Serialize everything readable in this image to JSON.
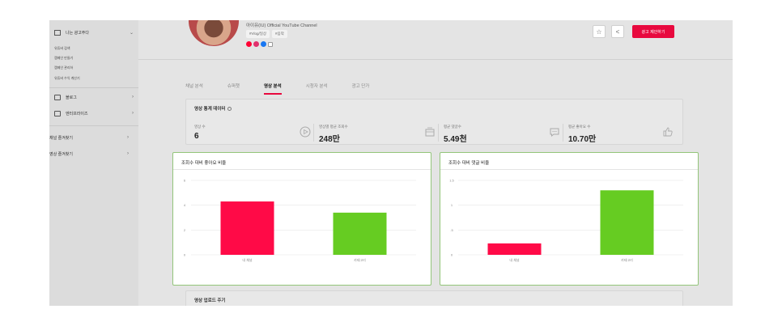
{
  "sidebar": {
    "head_label": "나는 광고주다",
    "sub_items": [
      "유튜버 검색",
      "캠페인 만들기",
      "캠페인 관리하",
      "유튜버 수익 계산기"
    ],
    "rows": [
      {
        "label": "블로그"
      },
      {
        "label": "엔터프라이즈"
      },
      {
        "label": "채널 즐겨찾기"
      },
      {
        "label": "영상 즐겨찾기"
      }
    ]
  },
  "channel": {
    "name": "아이유(IU) Official YouTube Channel",
    "tags": [
      "#Vlog/일상",
      "#음악"
    ]
  },
  "header": {
    "star_icon": "star-icon",
    "share_icon": "share-icon",
    "ad_button_label": "광고 제안하기"
  },
  "tabs": [
    "채널 분석",
    "슈퍼챗",
    "영상 분석",
    "시청자 분석",
    "광고 단가"
  ],
  "active_tab": 2,
  "stats": {
    "title": "영상 통계 데이터",
    "items": [
      {
        "label": "영상 수",
        "value": "6",
        "icon": "play-icon"
      },
      {
        "label": "영상별 평균 조회수",
        "value": "248만",
        "icon": "video-icon"
      },
      {
        "label": "평균 댓글수",
        "value": "5.49천",
        "icon": "comment-icon"
      },
      {
        "label": "평균 좋아요 수",
        "value": "10.70만",
        "icon": "thumbs-up-icon"
      }
    ]
  },
  "charts": {
    "like_ratio_title": "조회수 대비 좋아요 비율",
    "comment_ratio_title": "조회수 대비 댓글 비율"
  },
  "chart_data": [
    {
      "type": "bar",
      "title": "조회수 대비 좋아요 비율",
      "categories": [
        "내 채널",
        "카테고리"
      ],
      "values": [
        4.3,
        3.4
      ],
      "ylim": [
        0,
        6
      ],
      "yticks": [
        "0",
        "2",
        "4",
        "6"
      ],
      "colors": [
        "#ff0a47",
        "#66cc22"
      ],
      "grid": true
    },
    {
      "type": "bar",
      "title": "조회수 대비 댓글 비율",
      "categories": [
        "내 채널",
        "카테고리"
      ],
      "values": [
        0.23,
        1.3
      ],
      "ylim": [
        0,
        1.5
      ],
      "yticks": [
        "0",
        ".5",
        "1",
        "1.5"
      ],
      "colors": [
        "#ff0a47",
        "#66cc22"
      ],
      "grid": true
    }
  ],
  "upload": {
    "title": "영상 업로드 주기"
  }
}
